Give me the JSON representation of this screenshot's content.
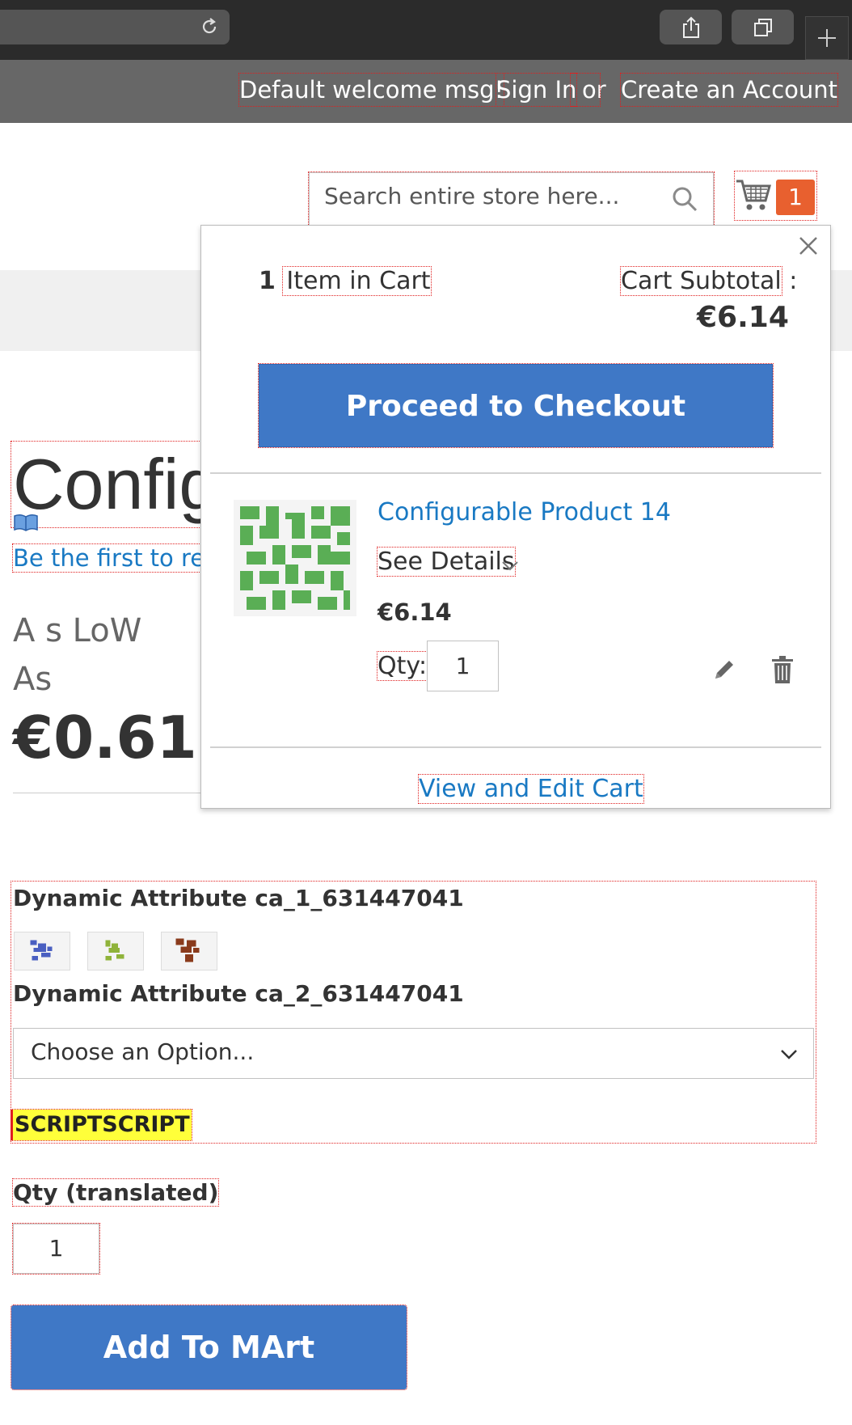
{
  "header": {
    "welcome": "Default welcome msg!",
    "sign_in": "Sign In",
    "or": "or",
    "create_account": "Create an Account"
  },
  "search": {
    "placeholder": "Search entire store here..."
  },
  "cart": {
    "count": "1"
  },
  "minicart": {
    "items_count": "1",
    "items_label": "Item in Cart",
    "subtotal_label": "Cart Subtotal",
    "subtotal_colon": ":",
    "subtotal_value": "€6.14",
    "checkout_label": "Proceed to Checkout",
    "product_name": "Configurable Product 14",
    "see_details": "See Details",
    "product_price": "€6.14",
    "qty_label": "Qty:",
    "qty_value": "1",
    "view_edit": "View and Edit Cart"
  },
  "product": {
    "title": "Config",
    "review_link": "Be the first to revi",
    "as_low_as": "A s LoW As",
    "price": "€0.61"
  },
  "options": {
    "attr1_label": "Dynamic Attribute ca_1_631447041",
    "attr2_label": "Dynamic Attribute ca_2_631447041",
    "select_value": "Choose an Option...",
    "script_text": "SCRIPTSCRIPT",
    "swatch_colors": [
      "#4a5fc1",
      "#8fb33a",
      "#8a3b1c"
    ]
  },
  "qty": {
    "label": "Qty (translated)",
    "value": "1"
  },
  "add_to_cart": "Add To MArt",
  "colors": {
    "accent": "#3f78c6",
    "link": "#1979c3",
    "cart_badge": "#e8602f"
  }
}
